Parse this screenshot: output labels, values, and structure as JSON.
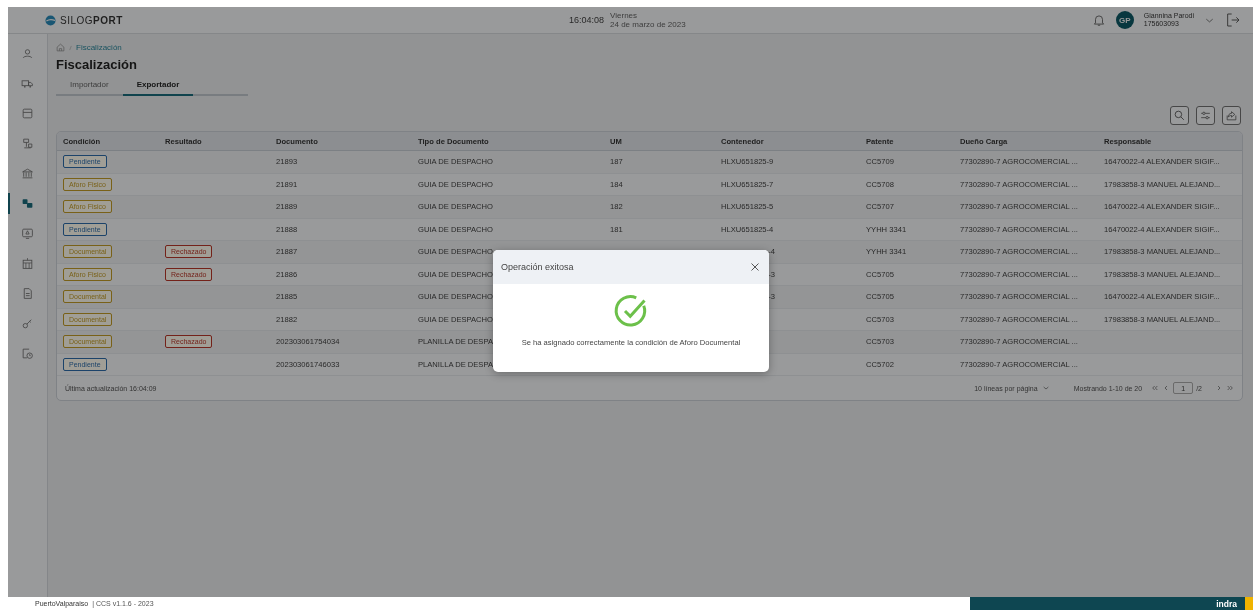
{
  "header": {
    "logo": "SILOG**PORT**",
    "time": "16:04:08",
    "weekday": "Viernes",
    "date": "24 de marzo de 2023",
    "user": {
      "initials": "GP",
      "name": "Giannina Parodi",
      "id": "175603093"
    }
  },
  "sidebar": {
    "items": [
      {
        "selected": false
      },
      {
        "selected": false
      },
      {
        "selected": false
      },
      {
        "selected": false
      },
      {
        "selected": false
      },
      {
        "selected": true
      },
      {
        "selected": false
      },
      {
        "selected": false
      },
      {
        "selected": false
      },
      {
        "selected": false
      },
      {
        "selected": false
      }
    ]
  },
  "breadcrumb": {
    "current": "Fiscalización"
  },
  "title": "Fiscalización",
  "tabs": [
    {
      "label": "Importador",
      "selected": false
    },
    {
      "label": "Exportador",
      "selected": true
    }
  ],
  "table": {
    "columns": [
      "Condición",
      "Resultado",
      "Documento",
      "Tipo de Documento",
      "UM",
      "Contenedor",
      "Patente",
      "Dueño Carga",
      "Responsable"
    ],
    "rows": [
      {
        "condition": {
          "text": "Pendiente",
          "color": "#1c436a"
        },
        "document": "21893",
        "doc_type": "GUIA DE DESPACHO",
        "um": "187",
        "container": "HLXU651825-9",
        "plate": "CC5709",
        "owner": "77302890-7 AGROCOMERCIAL ...",
        "responsible": "16470022-4 ALEXANDER SIGIF..."
      },
      {
        "condition": {
          "text": "Aforo Fisico",
          "color": "#796118"
        },
        "document": "21891",
        "doc_type": "GUIA DE DESPACHO",
        "um": "184",
        "container": "HLXU651825-7",
        "plate": "CC5708",
        "owner": "77302890-7 AGROCOMERCIAL ...",
        "responsible": "17983858-3 MANUEL ALEJAND..."
      },
      {
        "condition": {
          "text": "Aforo Fisico",
          "color": "#796118"
        },
        "document": "21889",
        "doc_type": "GUIA DE DESPACHO",
        "um": "182",
        "container": "HLXU651825-5",
        "plate": "CC5707",
        "owner": "77302890-7 AGROCOMERCIAL ...",
        "responsible": "16470022-4 ALEXANDER SIGIF..."
      },
      {
        "condition": {
          "text": "Pendiente",
          "color": "#1c436a"
        },
        "document": "21888",
        "doc_type": "GUIA DE DESPACHO",
        "um": "181",
        "container": "HLXU651825-4",
        "plate": "YYHH 3341",
        "owner": "77302890-7 AGROCOMERCIAL ...",
        "responsible": "16470022-4 ALEXANDER SIGIF..."
      },
      {
        "condition": {
          "text": "Documental",
          "color": "#796118"
        },
        "result": {
          "text": "Rechazado",
          "color": "#73221a"
        },
        "document": "21887",
        "doc_type": "GUIA DE DESPACHO",
        "container": "-4",
        "plate": "YYHH 3341",
        "owner": "77302890-7 AGROCOMERCIAL ...",
        "responsible": "17983858-3 MANUEL ALEJAND..."
      },
      {
        "condition": {
          "text": "Aforo Fisico",
          "color": "#796118"
        },
        "result": {
          "text": "Rechazado",
          "color": "#73221a"
        },
        "document": "21886",
        "doc_type": "GUIA DE DESPACHO",
        "container": "-3",
        "plate": "CC5705",
        "owner": "77302890-7 AGROCOMERCIAL ...",
        "responsible": "17983858-3 MANUEL ALEJAND..."
      },
      {
        "condition": {
          "text": "Documental",
          "color": "#796118"
        },
        "document": "21885",
        "doc_type": "GUIA DE DESPACHO",
        "container": "-3",
        "plate": "CC5705",
        "owner": "77302890-7 AGROCOMERCIAL ...",
        "responsible": "16470022-4 ALEXANDER SIGIF..."
      },
      {
        "condition": {
          "text": "Documental",
          "color": "#796118"
        },
        "document": "21882",
        "doc_type": "GUIA DE DESPACHO",
        "plate": "CC5703",
        "owner": "77302890-7 AGROCOMERCIAL ...",
        "responsible": "17983858-3 MANUEL ALEJAND..."
      },
      {
        "condition": {
          "text": "Documental",
          "color": "#796118"
        },
        "result": {
          "text": "Rechazado",
          "color": "#73221a"
        },
        "document": "202303061754034",
        "doc_type": "PLANILLA DE DESPA",
        "plate": "CC5703",
        "owner": "77302890-7 AGROCOMERCIAL ..."
      },
      {
        "condition": {
          "text": "Pendiente",
          "color": "#1c436a"
        },
        "document": "202303061746033",
        "doc_type": "PLANILLA DE DESPA",
        "plate": "CC5702",
        "owner": "77302890-7 AGROCOMERCIAL ..."
      }
    ],
    "last_update": "Última actualización 16:04:09",
    "page_size": "10 líneas por página",
    "range": "Mostrando 1-10 de 20",
    "page": "1",
    "pages": "/2"
  },
  "dialog": {
    "title": "Operación exitosa",
    "message": "Se ha asignado correctamente la condición de Aforo Documental"
  },
  "footer": {
    "brand": "PuertoValparaiso",
    "version": "| CCS v1.1.6 - 2023",
    "vendor": "indra"
  }
}
